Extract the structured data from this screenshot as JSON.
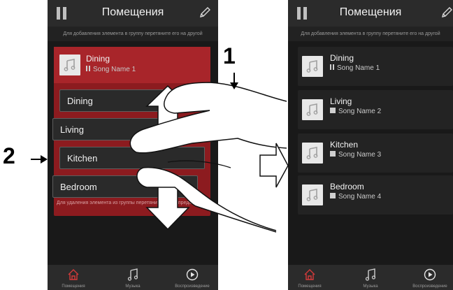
{
  "screen_title": "Помещения",
  "hint_top": "Для добавления элемента в группу перетяните его на другой",
  "hint_bottom": "Для удаления элемента из группы перетяните его за пределы",
  "callouts": [
    "1",
    "2"
  ],
  "left_phone": {
    "group_header": {
      "room": "Dining",
      "song": "Song Name 1"
    },
    "slots": [
      "Dining",
      "Living",
      "Kitchen",
      "Bedroom"
    ]
  },
  "right_phone": {
    "rows": [
      {
        "room": "Dining",
        "song": "Song Name 1",
        "icon": "pause"
      },
      {
        "room": "Living",
        "song": "Song Name 2",
        "icon": "stop"
      },
      {
        "room": "Kitchen",
        "song": "Song Name 3",
        "icon": "stop"
      },
      {
        "room": "Bedroom",
        "song": "Song Name 4",
        "icon": "stop"
      }
    ]
  },
  "tabs": [
    "Помещения",
    "Музыка",
    "Воспроизведение"
  ],
  "colors": {
    "accent_red": "#a8252a",
    "group_bg": "#8c1b1f",
    "tab_active": "#d43a3a"
  }
}
